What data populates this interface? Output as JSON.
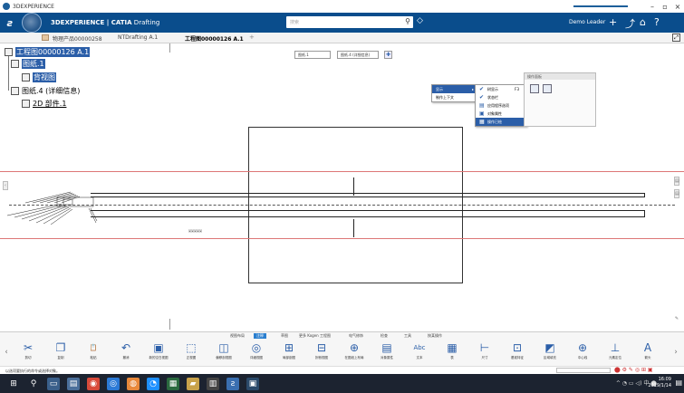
{
  "os_window": {
    "title": "3DEXPERIENCE"
  },
  "header": {
    "brand": "3DEXPERIENCE | CATIA Drafting",
    "brand_bold": "3DEXPERIENCE | CATIA",
    "brand_rest": " Drafting",
    "search_placeholder": "搜索",
    "user": "Demo Leader"
  },
  "tabs": [
    {
      "label": "物理产品00000258"
    },
    {
      "label": "NTDrafting A.1"
    },
    {
      "label": "工程图00000126 A.1"
    }
  ],
  "tree": {
    "root": "工程图00000126 A.1",
    "sheet1": "图纸.1",
    "bg_view": "背视图",
    "sheet4": "图纸.4 (详细信息)",
    "component": "2D 部件.1"
  },
  "mini_toolbar": {
    "sheet_field": "图纸.1",
    "detail_field": "图纸.4 (详细信息)"
  },
  "context_menu": {
    "parent_items": [
      "显示",
      "制作上下文"
    ],
    "sub_items": [
      {
        "label": "树显示",
        "accel": "F3",
        "checked": true
      },
      {
        "label": "状态栏",
        "accel": "",
        "checked": true
      },
      {
        "label": "应用程序选项",
        "accel": "",
        "checked": false
      },
      {
        "label": "对象属性",
        "accel": "",
        "checked": false
      },
      {
        "label": "操作已绘",
        "accel": "",
        "checked": false,
        "selected": true
      }
    ]
  },
  "palette": {
    "title": "操作面板"
  },
  "drawing_caption": "某某某某某",
  "action_bar": {
    "tabs": [
      "视图布局",
      "注释",
      "草图",
      "更多 Kogen 工程图",
      "电气修饰",
      "检查",
      "工具",
      "按某操作"
    ],
    "active_tab": "注释",
    "tools": [
      {
        "icon": "scissors-icon",
        "glyph": "✂",
        "label": "剪切"
      },
      {
        "icon": "copy-icon",
        "glyph": "❐",
        "label": "复制"
      },
      {
        "icon": "paste-icon",
        "glyph": "📋",
        "label": "粘贴"
      },
      {
        "icon": "undo-icon",
        "glyph": "↶",
        "label": "撤消"
      },
      {
        "icon": "new-view-icon",
        "glyph": "▣",
        "label": "新的空白视图"
      },
      {
        "icon": "front-view-icon",
        "glyph": "⬚",
        "label": "正视图"
      },
      {
        "icon": "projection-icon",
        "glyph": "◫",
        "label": "偏移剖视图"
      },
      {
        "icon": "detail-view-icon",
        "glyph": "◎",
        "label": "详细视图"
      },
      {
        "icon": "clipping-icon",
        "glyph": "⊞",
        "label": "局部剖图"
      },
      {
        "icon": "broken-view-icon",
        "glyph": "⊟",
        "label": "折断视图"
      },
      {
        "icon": "dimension-icon",
        "glyph": "⊕",
        "label": "在图纸上布局"
      },
      {
        "icon": "object-props-icon",
        "glyph": "▤",
        "label": "对象属性"
      },
      {
        "icon": "text-icon",
        "glyph": "Abc",
        "label": "文本"
      },
      {
        "icon": "table-icon",
        "glyph": "▦",
        "label": "表"
      },
      {
        "icon": "size-icon",
        "glyph": "⊢",
        "label": "尺寸"
      },
      {
        "icon": "datum-icon",
        "glyph": "⊡",
        "label": "基准特征"
      },
      {
        "icon": "area-fill-icon",
        "glyph": "◩",
        "label": "区域填充"
      },
      {
        "icon": "centerline-icon",
        "glyph": "⊕",
        "label": "中心线"
      },
      {
        "icon": "sym-icon",
        "glyph": "⊥",
        "label": "元素定位"
      },
      {
        "icon": "arrow-icon",
        "glyph": "A",
        "label": "箭头"
      }
    ]
  },
  "status_bar": {
    "text": "以选项要执行的命令或选择对象。"
  },
  "taskbar": {
    "clock_time": "16:09",
    "clock_date": "2019/1/14"
  }
}
